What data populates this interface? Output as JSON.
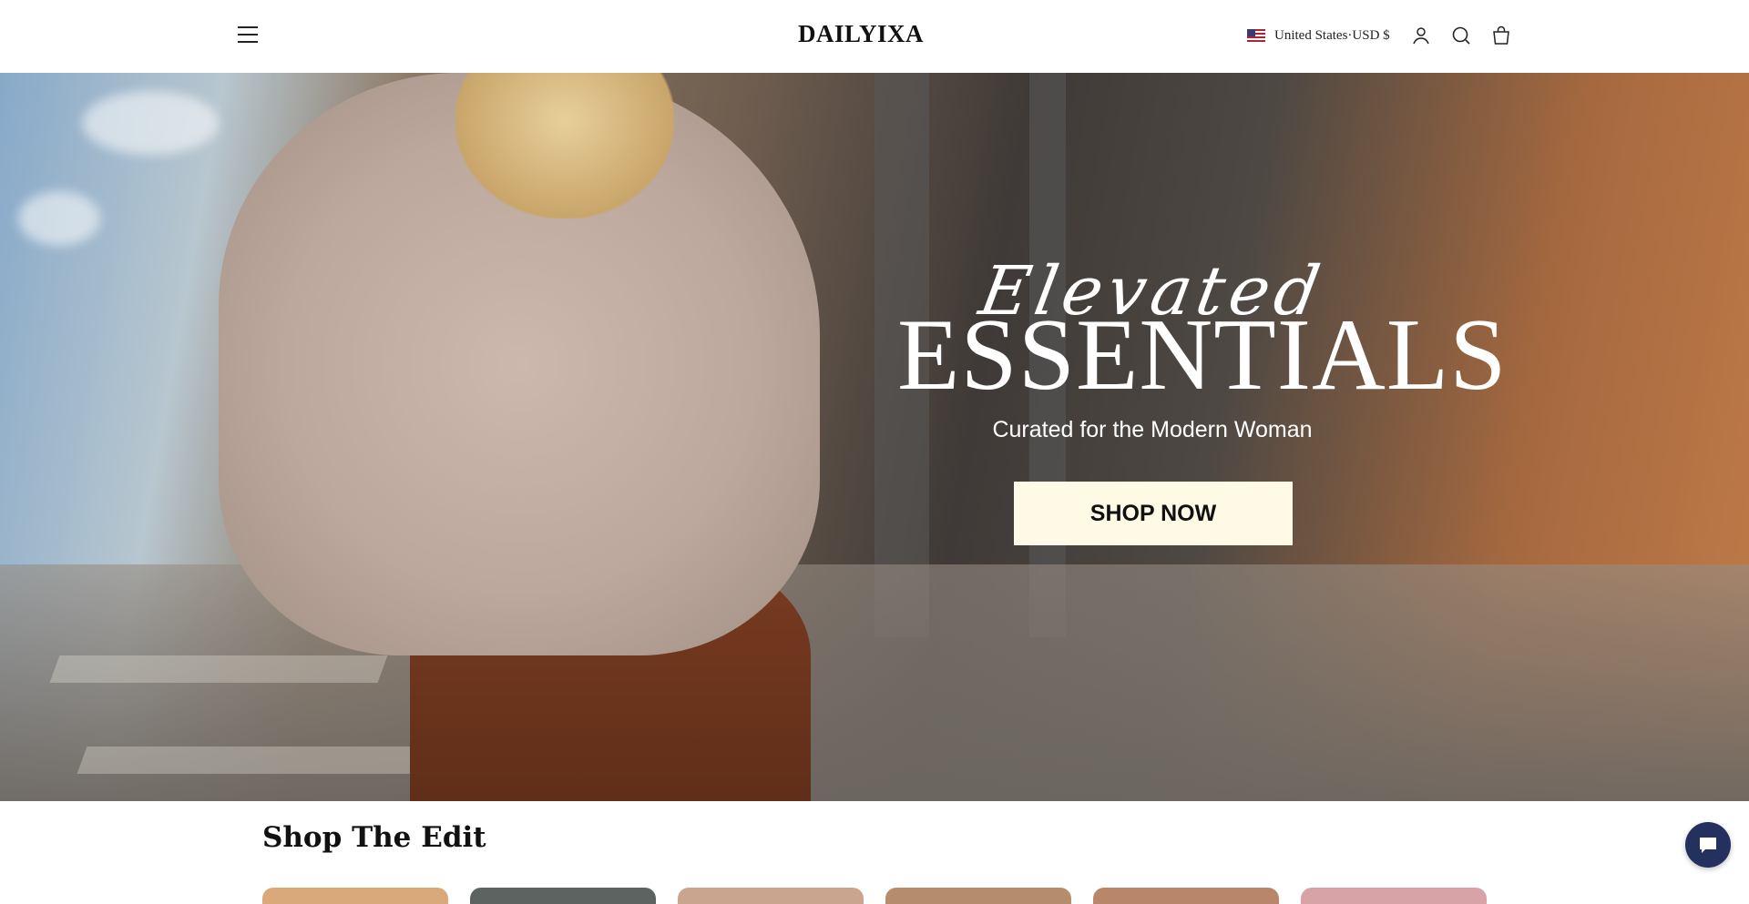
{
  "header": {
    "logo": "DAILYIXA",
    "locale": "United States·USD $",
    "icons": [
      "menu-icon",
      "flag-us-icon",
      "account-icon",
      "search-icon",
      "cart-icon"
    ]
  },
  "hero": {
    "script_text": "Elevated",
    "title": "ESSENTIALS",
    "subtitle": "Curated for the Modern Woman",
    "cta_label": "SHOP NOW",
    "cta_color": "#fffae6"
  },
  "shop_the_edit": {
    "title": "Shop The Edit",
    "cards": [
      {
        "color": "#d9a97a"
      },
      {
        "color": "#5c6360"
      },
      {
        "color": "#c9a48e"
      },
      {
        "color": "#b58d6c"
      },
      {
        "color": "#b8876a"
      },
      {
        "color": "#d8a3a6"
      }
    ]
  },
  "chat": {
    "icon": "chat-icon",
    "color": "#24305e"
  }
}
